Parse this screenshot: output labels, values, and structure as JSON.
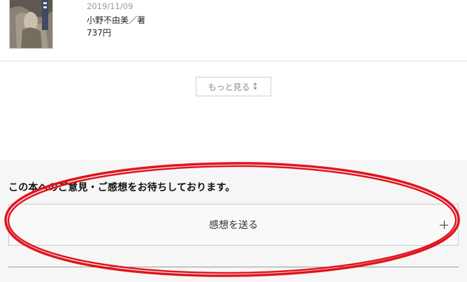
{
  "book": {
    "date": "2019/11/09",
    "author": "小野不由美／著",
    "price": "737円"
  },
  "more_button": {
    "label": "もっと見る",
    "arrow": "↕"
  },
  "feedback": {
    "heading": "この本へのご意見・ご感想をお待ちしております。",
    "toggle_label": "感想を送る"
  },
  "colors": {
    "annotation": "#e0141e",
    "section_bg": "#f6f6f6"
  },
  "icons": {
    "expand": "plus-icon",
    "more": "up-down-arrow-icon"
  }
}
